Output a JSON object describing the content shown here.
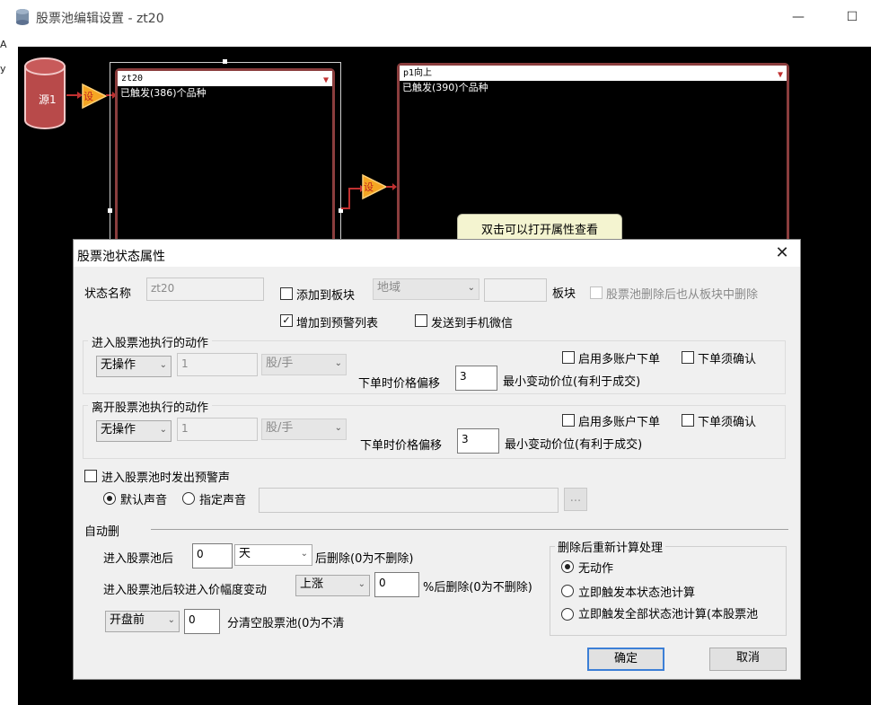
{
  "window": {
    "title": "股票池编辑设置 - zt20"
  },
  "left_strip": [
    "A",
    "y"
  ],
  "canvas": {
    "source_label": "源1",
    "setter_label": "设",
    "pools": [
      {
        "name": "zt20",
        "info": "已触发(386)个品种"
      },
      {
        "name": "p1向上",
        "info": "已触发(390)个品种"
      }
    ],
    "tooltip": "双击可以打开属性查看"
  },
  "dialog": {
    "title": "股票池状态属性",
    "state_name_label": "状态名称",
    "state_name_value": "zt20",
    "add_to_block_label": "添加到板块",
    "region_select": "地域",
    "block_label": "板块",
    "delete_from_block_label": "股票池删除后也从板块中删除",
    "add_to_warning_label": "增加到预警列表",
    "send_wechat_label": "发送到手机微信",
    "enter_group": {
      "title": "进入股票池执行的动作",
      "action": "无操作",
      "qty": "1",
      "unit": "股/手",
      "multi_account": "启用多账户下单",
      "confirm": "下单须确认",
      "price_offset_label": "下单时价格偏移",
      "price_offset_value": "3",
      "min_tick_label": "最小变动价位(有利于成交)"
    },
    "exit_group": {
      "title": "离开股票池执行的动作",
      "action": "无操作",
      "qty": "1",
      "unit": "股/手",
      "multi_account": "启用多账户下单",
      "confirm": "下单须确认",
      "price_offset_label": "下单时价格偏移",
      "price_offset_value": "3",
      "min_tick_label": "最小变动价位(有利于成交)"
    },
    "sound_label": "进入股票池时发出预警声",
    "default_sound": "默认声音",
    "custom_sound": "指定声音",
    "browse": "...",
    "auto_delete": {
      "title": "自动删",
      "row1_prefix": "进入股票池后",
      "row1_value": "0",
      "row1_unit": "天",
      "row1_suffix": "后删除(0为不删除)",
      "row2_prefix": "进入股票池后较进入价幅度变动",
      "row2_dir": "上涨",
      "row2_value": "0",
      "row2_suffix": "%后删除(0为不删除)",
      "row3_when": "开盘前",
      "row3_value": "0",
      "row3_suffix": "分清空股票池(0为不清"
    },
    "recalc": {
      "title": "删除后重新计算处理",
      "opt1": "无动作",
      "opt2": "立即触发本状态池计算",
      "opt3": "立即触发全部状态池计算(本股票池"
    },
    "ok": "确定",
    "cancel": "取消"
  },
  "colors": {
    "pool_border": "#8a3d3d",
    "setter": "#f5a623",
    "source": "#b84a4a"
  }
}
